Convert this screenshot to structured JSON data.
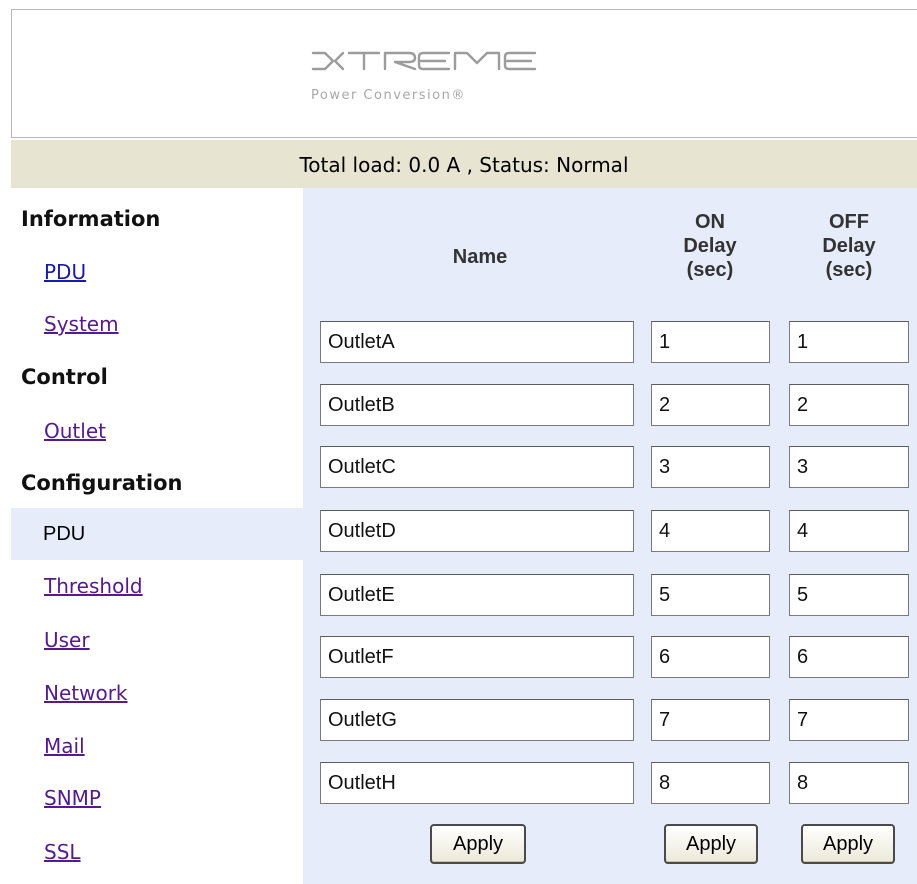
{
  "brand": {
    "logo_text": "XTREME",
    "tagline": "Power Conversion®"
  },
  "status": {
    "text": "Total load: 0.0 A , Status: Normal"
  },
  "sidebar": {
    "information": {
      "title": "Information",
      "items": [
        "PDU",
        "System"
      ]
    },
    "control": {
      "title": "Control",
      "items": [
        "Outlet"
      ]
    },
    "configuration": {
      "title": "Configuration",
      "items": [
        "PDU",
        "Threshold",
        "User",
        "Network",
        "Mail",
        "SNMP",
        "SSL"
      ]
    },
    "active_item": "Configuration > PDU"
  },
  "table": {
    "headers": {
      "name": "Name",
      "on_delay": [
        "ON",
        "Delay",
        "(sec)"
      ],
      "off_delay": [
        "OFF",
        "Delay",
        "(sec)"
      ]
    },
    "rows": [
      {
        "name": "OutletA",
        "on": "1",
        "off": "1"
      },
      {
        "name": "OutletB",
        "on": "2",
        "off": "2"
      },
      {
        "name": "OutletC",
        "on": "3",
        "off": "3"
      },
      {
        "name": "OutletD",
        "on": "4",
        "off": "4"
      },
      {
        "name": "OutletE",
        "on": "5",
        "off": "5"
      },
      {
        "name": "OutletF",
        "on": "6",
        "off": "6"
      },
      {
        "name": "OutletG",
        "on": "7",
        "off": "7"
      },
      {
        "name": "OutletH",
        "on": "8",
        "off": "8"
      }
    ],
    "apply_label": "Apply"
  },
  "colors": {
    "status_bg": "#e8e4d2",
    "panel_bg": "#e6ecf9",
    "link_visited": "#551a8b",
    "link": "#1a1aa6"
  }
}
